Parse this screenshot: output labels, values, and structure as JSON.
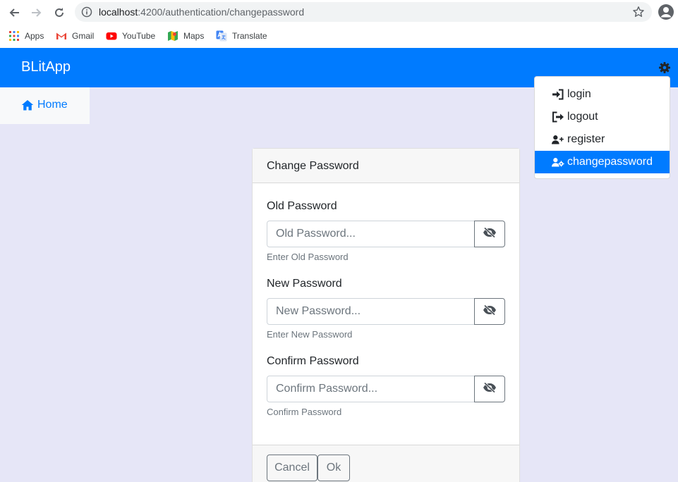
{
  "browser": {
    "url_host": "localhost",
    "url_rest": ":4200/authentication/changepassword",
    "bookmarks": [
      {
        "label": "Apps",
        "icon": "apps-grid-icon"
      },
      {
        "label": "Gmail",
        "icon": "gmail-icon"
      },
      {
        "label": "YouTube",
        "icon": "youtube-icon"
      },
      {
        "label": "Maps",
        "icon": "maps-icon"
      },
      {
        "label": "Translate",
        "icon": "translate-icon"
      }
    ]
  },
  "app": {
    "brand": "BLitApp",
    "header_color": "#007bff",
    "background_color": "#e6e6f7"
  },
  "sidebar": {
    "home_label": "Home"
  },
  "settings_menu": {
    "items": [
      {
        "label": "login",
        "icon": "sign-in-icon",
        "active": false
      },
      {
        "label": "logout",
        "icon": "sign-out-icon",
        "active": false
      },
      {
        "label": "register",
        "icon": "user-plus-icon",
        "active": false
      },
      {
        "label": "changepassword",
        "icon": "user-cog-icon",
        "active": true
      }
    ]
  },
  "form": {
    "title": "Change Password",
    "fields": [
      {
        "label": "Old Password",
        "placeholder": "Old Password...",
        "help": "Enter Old Password"
      },
      {
        "label": "New Password",
        "placeholder": "New Password...",
        "help": "Enter New Password"
      },
      {
        "label": "Confirm Password",
        "placeholder": "Confirm Password...",
        "help": "Confirm Password"
      }
    ],
    "cancel_label": "Cancel",
    "ok_label": "Ok"
  }
}
